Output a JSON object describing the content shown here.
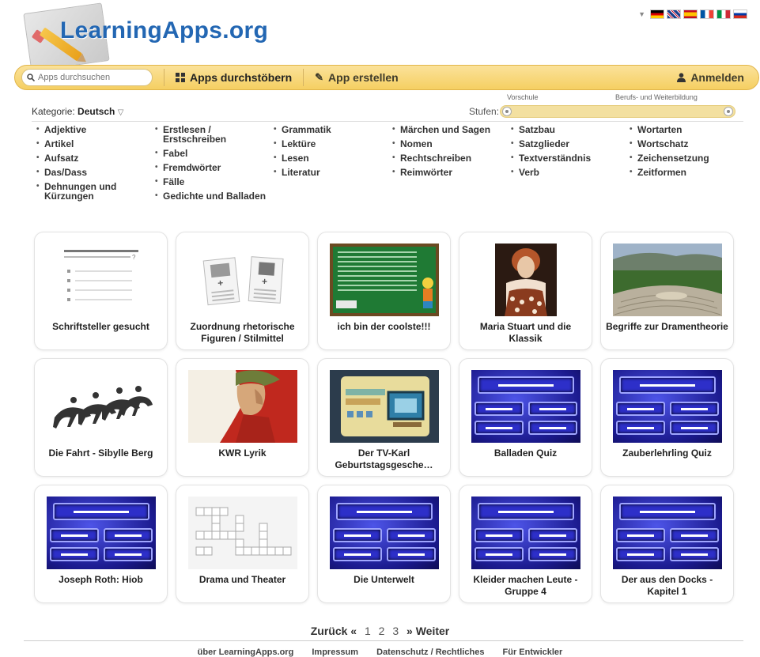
{
  "header": {
    "logo_text": "LearningApps.org",
    "languages": [
      "de",
      "gb",
      "es",
      "fr",
      "it",
      "ru"
    ]
  },
  "nav": {
    "search_placeholder": "Apps durchsuchen",
    "browse_label": "Apps durchstöbern",
    "create_label": "App erstellen",
    "login_label": "Anmelden"
  },
  "filter": {
    "kategorie_label": "Kategorie:",
    "kategorie_value": "Deutsch",
    "stufen_label": "Stufen:",
    "stufen_min": "Vorschule",
    "stufen_max": "Berufs- und Weiterbildung"
  },
  "categories": [
    [
      "Adjektive",
      "Artikel",
      "Aufsatz",
      "Das/Dass",
      "Dehnungen und Kürzungen"
    ],
    [
      "Erstlesen / Erstschreiben",
      "Fabel",
      "Fremdwörter",
      "Fälle",
      "Gedichte und Balladen"
    ],
    [
      "Grammatik",
      "Lektüre",
      "Lesen",
      "Literatur"
    ],
    [
      "Märchen und Sagen",
      "Nomen",
      "Rechtschreiben",
      "Reimwörter"
    ],
    [
      "Satzbau",
      "Satzglieder",
      "Textverständnis",
      "Verb"
    ],
    [
      "Wortarten",
      "Wortschatz",
      "Zeichensetzung",
      "Zeitformen"
    ]
  ],
  "apps": [
    {
      "title": "Schriftsteller gesucht",
      "thumb": "list"
    },
    {
      "title": "Zuordnung rhetorische Figuren / Stilmittel",
      "thumb": "pair"
    },
    {
      "title": "ich bin der coolste!!!",
      "thumb": "chalkboard"
    },
    {
      "title": "Maria Stuart und die Klassik",
      "thumb": "portrait"
    },
    {
      "title": "Begriffe zur Dramentheorie",
      "thumb": "theater"
    },
    {
      "title": "Die Fahrt - Sibylle Berg",
      "thumb": "riders"
    },
    {
      "title": "KWR Lyrik",
      "thumb": "dante"
    },
    {
      "title": "Der TV-Karl Geburtstagsgesche…",
      "thumb": "tv"
    },
    {
      "title": "Balladen Quiz",
      "thumb": "quiz"
    },
    {
      "title": "Zauberlehrling Quiz",
      "thumb": "quiz"
    },
    {
      "title": "Joseph Roth: Hiob",
      "thumb": "quiz"
    },
    {
      "title": "Drama und Theater",
      "thumb": "crossword"
    },
    {
      "title": "Die Unterwelt",
      "thumb": "quiz"
    },
    {
      "title": "Kleider machen Leute - Gruppe 4",
      "thumb": "quiz"
    },
    {
      "title": "Der aus den Docks - Kapitel 1",
      "thumb": "quiz"
    }
  ],
  "pagination": {
    "prev": "Zurück «",
    "pages": [
      "1",
      "2",
      "3"
    ],
    "next": "» Weiter"
  },
  "footer": [
    "über LearningApps.org",
    "Impressum",
    "Datenschutz / Rechtliches",
    "Für Entwickler"
  ],
  "colors": {
    "brand_blue": "#2367b3",
    "nav_yellow": "#f5cf62",
    "quiz_blue": "#1b1a8e"
  }
}
